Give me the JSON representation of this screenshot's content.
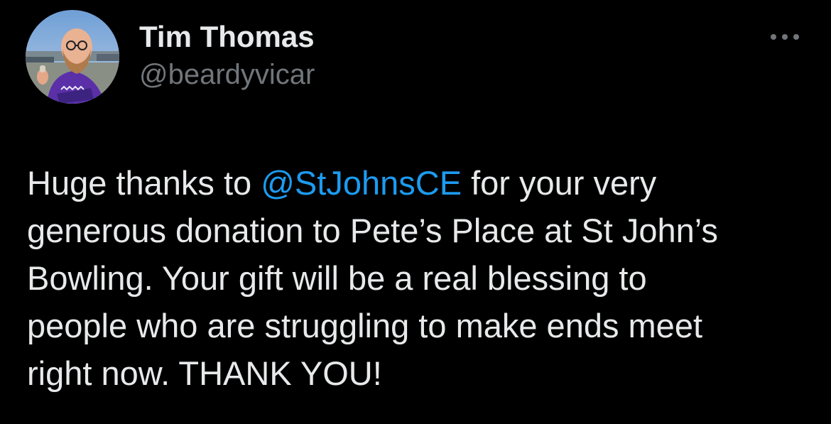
{
  "author": {
    "display_name": "Tim Thomas",
    "handle": "@beardyvicar",
    "avatar_icon": "profile-photo"
  },
  "more_icon": "more-dots-icon",
  "tweet": {
    "line1_before": "Huge thanks to ",
    "mention": "@StJohnsCE",
    "line1_after": " for your very",
    "line2": "generous donation to Pete’s Place at St John’s",
    "line3": "Bowling. Your gift will be a real blessing to",
    "line4": "people who are struggling to make ends meet",
    "line5": "right now. THANK YOU!"
  },
  "colors": {
    "background": "#000000",
    "text": "#e7e9ea",
    "secondary": "#71767b",
    "link": "#1d9bf0"
  }
}
